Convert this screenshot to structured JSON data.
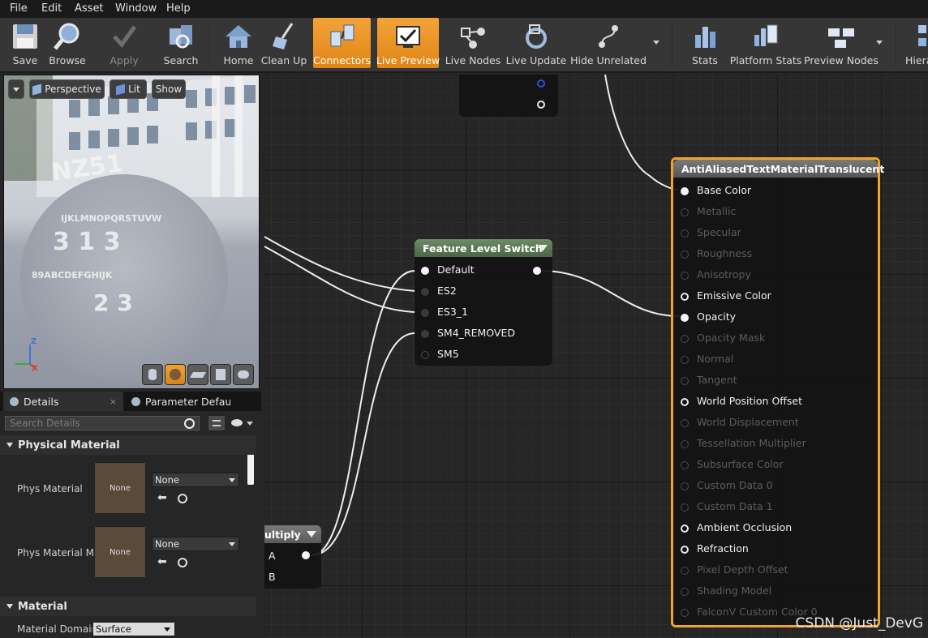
{
  "menu": [
    "File",
    "Edit",
    "Asset",
    "Window",
    "Help"
  ],
  "toolbar": {
    "save": "Save",
    "browse": "Browse",
    "apply": "Apply",
    "search": "Search",
    "home": "Home",
    "cleanup": "Clean Up",
    "connectors": "Connectors",
    "live_preview": "Live Preview",
    "live_nodes": "Live Nodes",
    "live_update": "Live Update",
    "hide_unrelated": "Hide Unrelated",
    "stats": "Stats",
    "platform_stats": "Platform Stats",
    "preview_nodes": "Preview Nodes",
    "hierarchy": "Hiera"
  },
  "viewport": {
    "perspective": "Perspective",
    "lit": "Lit",
    "show": "Show",
    "axis_z": "Z",
    "axis_x": "X"
  },
  "details": {
    "tab_details": "Details",
    "tab_params": "Parameter Defaults",
    "search_placeholder": "Search Details",
    "sections": {
      "physical": "Physical Material",
      "material": "Material"
    },
    "phys_material": "Phys Material",
    "phys_material_mask": "Phys Material Ma",
    "none_thumb": "None",
    "none_value": "None",
    "material_domain": "Material Domain",
    "surface": "Surface"
  },
  "graph": {
    "fls": {
      "title": "Feature Level Switch",
      "inputs": [
        "Default",
        "ES2",
        "ES3_1",
        "SM4_REMOVED",
        "SM5"
      ]
    },
    "multiply": {
      "title": "ultiply",
      "inputs": [
        "A",
        "B"
      ]
    },
    "result": {
      "title": "AntiAliasedTextMaterialTranslucent",
      "pins": [
        {
          "label": "Base Color",
          "state": "on"
        },
        {
          "label": "Metallic",
          "state": "off"
        },
        {
          "label": "Specular",
          "state": "off"
        },
        {
          "label": "Roughness",
          "state": "off"
        },
        {
          "label": "Anisotropy",
          "state": "off"
        },
        {
          "label": "Emissive Color",
          "state": "hollow"
        },
        {
          "label": "Opacity",
          "state": "on"
        },
        {
          "label": "Opacity Mask",
          "state": "off"
        },
        {
          "label": "Normal",
          "state": "off"
        },
        {
          "label": "Tangent",
          "state": "off"
        },
        {
          "label": "World Position Offset",
          "state": "hollow"
        },
        {
          "label": "World Displacement",
          "state": "off"
        },
        {
          "label": "Tessellation Multiplier",
          "state": "off"
        },
        {
          "label": "Subsurface Color",
          "state": "off"
        },
        {
          "label": "Custom Data 0",
          "state": "off"
        },
        {
          "label": "Custom Data 1",
          "state": "off"
        },
        {
          "label": "Ambient Occlusion",
          "state": "hollow"
        },
        {
          "label": "Refraction",
          "state": "hollow"
        },
        {
          "label": "Pixel Depth Offset",
          "state": "off"
        },
        {
          "label": "Shading Model",
          "state": "off"
        },
        {
          "label": "FalconV Custom Color 0",
          "state": "off"
        }
      ]
    }
  },
  "watermark": "CSDN @Just_DevG",
  "colors": {
    "accent": "#f0a22e",
    "node_green": "#5f7f57",
    "node_gray": "#707070"
  }
}
